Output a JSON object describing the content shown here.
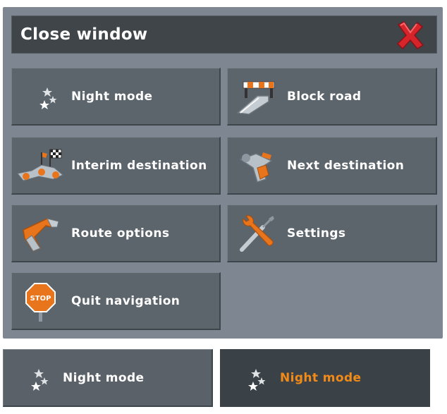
{
  "close_window": {
    "label": "Close window",
    "icon": "close-x-icon"
  },
  "menu": {
    "night_mode": "Night mode",
    "block_road": "Block road",
    "interim_destination": "Interim destination",
    "next_destination": "Next destination",
    "route_options": "Route options",
    "settings": "Settings",
    "quit_navigation": "Quit navigation",
    "stop_sign_text": "STOP"
  },
  "states": {
    "normal": "Night mode",
    "selected": "Night mode"
  },
  "colors": {
    "panel": "#7e8791",
    "button": "#5c646c",
    "bar": "#3f4549",
    "selected_text": "#f28a17",
    "accent_orange": "#e8741c",
    "close_red": "#d6242b"
  }
}
